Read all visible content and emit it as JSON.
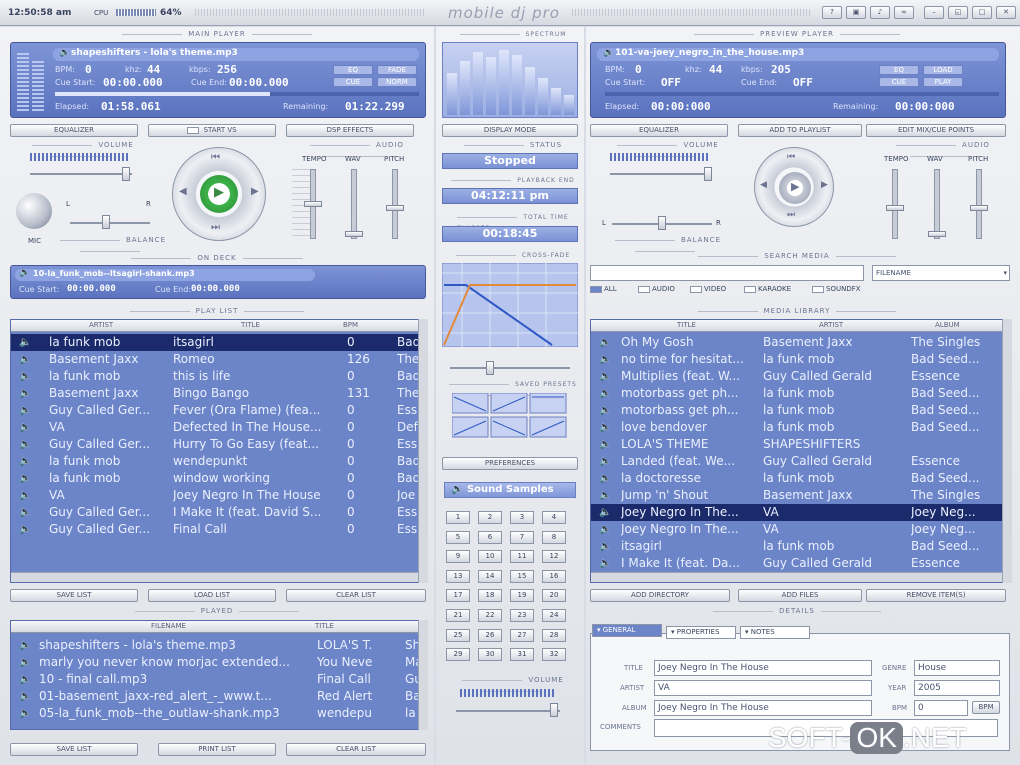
{
  "titlebar": {
    "clock": "12:50:58 am",
    "cpu_label": "CPU",
    "cpu_value": "64%",
    "app_title": "mobile dj pro",
    "window_buttons": [
      "?",
      "cam",
      "note",
      "link",
      "min",
      "max",
      "restore",
      "close"
    ]
  },
  "main_player": {
    "header": "Main Player",
    "track": "shapeshifters - lola's theme.mp3",
    "bpm_label": "BPM:",
    "bpm": "0",
    "khz_label": "khz:",
    "khz": "44",
    "kbps_label": "kbps:",
    "kbps": "256",
    "cue_start_label": "Cue Start:",
    "cue_start": "00:00.000",
    "cue_end_label": "Cue End:",
    "cue_end": "00:00.000",
    "mode_buttons": [
      "EQ",
      "FADE",
      "CUE",
      "NORM"
    ],
    "elapsed_label": "Elapsed:",
    "elapsed": "01:58.061",
    "remaining_label": "Remaining:",
    "remaining": "01:22.299",
    "progress": 0.59,
    "buttons": {
      "equalizer": "Equalizer",
      "start_vs": "Start VS",
      "dsp_effects": "DSP Effects"
    },
    "volume_header": "Volume",
    "audio_header": "Audio",
    "tempo": "Tempo",
    "wav": "WAV",
    "pitch": "Pitch",
    "mic": "MIC",
    "balance": "Balance",
    "l": "L",
    "r": "R"
  },
  "spectrum": {
    "header": "Spectrum Analyzer",
    "bars": [
      0.62,
      0.8,
      0.92,
      0.85,
      0.95,
      0.88,
      0.7,
      0.55,
      0.4,
      0.3
    ],
    "display_mode": "Display Mode",
    "status_header": "Status",
    "status": "Stopped",
    "playback_end_header": "Playback End",
    "playback_end": "04:12:11 pm",
    "total_elapsed_header": "Total Time Elapsed",
    "total_elapsed": "00:18:45",
    "crossfade_header": "Cross-fade",
    "saved_presets_header": "Saved Presets",
    "preferences": "Preferences",
    "sound_samples": "Sound Samples",
    "pads": [
      "1",
      "2",
      "3",
      "4",
      "5",
      "6",
      "7",
      "8",
      "9",
      "10",
      "11",
      "12",
      "13",
      "14",
      "15",
      "16",
      "17",
      "18",
      "19",
      "20",
      "21",
      "22",
      "23",
      "24",
      "25",
      "26",
      "27",
      "28",
      "29",
      "30",
      "31",
      "32"
    ],
    "volume": "Volume"
  },
  "on_deck": {
    "header": "On Deck",
    "track": "10-la_funk_mob--ltsagirl-shank.mp3",
    "cue_start_label": "Cue Start:",
    "cue_start": "00:00.000",
    "cue_end_label": "Cue End:",
    "cue_end": "00:00.000"
  },
  "playlist": {
    "header": "Play List",
    "columns": [
      "Artist",
      "Title",
      "BPM"
    ],
    "rows": [
      [
        "la funk mob",
        "itsagirl",
        "0",
        "Bad"
      ],
      [
        "Basement Jaxx",
        "Romeo",
        "126",
        "The"
      ],
      [
        "la funk mob",
        "this is life",
        "0",
        "Bad"
      ],
      [
        "Basement Jaxx",
        "Bingo Bango",
        "131",
        "The"
      ],
      [
        "Guy Called Ger...",
        "Fever (Ora Flame) (fea...",
        "0",
        "Ess"
      ],
      [
        "VA",
        "Defected In The House...",
        "0",
        "Def"
      ],
      [
        "Guy Called Ger...",
        "Hurry To Go Easy (feat...",
        "0",
        "Ess"
      ],
      [
        "la funk mob",
        "wendepunkt",
        "0",
        "Bad"
      ],
      [
        "la funk mob",
        "window working",
        "0",
        "Bad"
      ],
      [
        "VA",
        "Joey Negro In The House",
        "0",
        "Joe"
      ],
      [
        "Guy Called Ger...",
        "I Make It (feat. David S...",
        "0",
        "Ess"
      ],
      [
        "Guy Called Ger...",
        "Final Call",
        "0",
        "Ess"
      ]
    ],
    "buttons": [
      "Save List",
      "Load List",
      "Clear List"
    ]
  },
  "played": {
    "header": "Played",
    "columns": [
      "Filename",
      "Title"
    ],
    "rows": [
      [
        "shapeshifters - lola's theme.mp3",
        "LOLA'S T...",
        "Sh"
      ],
      [
        "marly you never know morjac extended...",
        "You Neve...",
        "Ma"
      ],
      [
        "10 - final call.mp3",
        "Final Call",
        "Gu"
      ],
      [
        "01-basement_jaxx-red_alert_-_www.t...",
        "Red Alert",
        "Ba"
      ],
      [
        "05-la_funk_mob--the_outlaw-shank.mp3",
        "wendepu...",
        "la"
      ]
    ],
    "buttons": [
      "Save List",
      "Print List",
      "Clear List"
    ]
  },
  "preview_player": {
    "header": "Preview Player",
    "track": "101-va-joey_negro_in_the_house.mp3",
    "bpm_label": "BPM:",
    "bpm": "0",
    "khz_label": "khz:",
    "khz": "44",
    "kbps_label": "kbps:",
    "kbps": "205",
    "cue_start_label": "Cue Start:",
    "cue_start": "OFF",
    "cue_end_label": "Cue End:",
    "cue_end": "OFF",
    "mode_buttons": [
      "EQ",
      "LOAD",
      "CUE",
      "PLAY"
    ],
    "elapsed_label": "Elapsed:",
    "elapsed": "00:00:000",
    "remaining_label": "Remaining:",
    "remaining": "00:00:000",
    "buttons": {
      "equalizer": "Equalizer",
      "add_playlist": "Add to Playlist",
      "edit_mix": "Edit Mix/Cue Points"
    },
    "volume_header": "Volume",
    "audio_header": "Audio",
    "tempo": "Tempo",
    "wav": "WAV",
    "pitch": "Pitch",
    "balance": "Balance",
    "l": "L",
    "r": "R"
  },
  "search": {
    "header": "Search Media",
    "value": "",
    "field_select": "Filename",
    "filters": [
      "All",
      "Audio",
      "Video",
      "Karaoke",
      "Soundfx"
    ]
  },
  "library": {
    "header": "Media Library",
    "columns": [
      "Title",
      "Artist",
      "Album"
    ],
    "rows": [
      [
        "Oh My Gosh",
        "Basement Jaxx",
        "The Singles"
      ],
      [
        "no time for hesitat...",
        "la funk mob",
        "Bad Seed..."
      ],
      [
        "Multiplies (feat. W...",
        "Guy Called Gerald",
        "Essence"
      ],
      [
        "motorbass get ph...",
        "la funk mob",
        "Bad Seed..."
      ],
      [
        "motorbass get ph...",
        "la funk mob",
        "Bad Seed..."
      ],
      [
        "love bendover",
        "la funk mob",
        "Bad Seed..."
      ],
      [
        "LOLA'S THEME",
        "SHAPESHIFTERS",
        ""
      ],
      [
        "Landed (feat. We...",
        "Guy Called Gerald",
        "Essence"
      ],
      [
        "la doctoresse",
        "la funk mob",
        "Bad Seed..."
      ],
      [
        "Jump 'n' Shout",
        "Basement Jaxx",
        "The Singles"
      ],
      [
        "Joey Negro In The...",
        "VA",
        "Joey Neg..."
      ],
      [
        "Joey Negro In The...",
        "VA",
        "Joey Neg..."
      ],
      [
        "itsagirl",
        "la funk mob",
        "Bad Seed..."
      ],
      [
        "I Make It (feat. Da...",
        "Guy Called Gerald",
        "Essence"
      ]
    ],
    "selected_index": 10,
    "buttons": [
      "Add Directory",
      "Add Files",
      "Remove Item(s)"
    ]
  },
  "details": {
    "header": "Details",
    "tabs": [
      "General",
      "Properties",
      "Notes"
    ],
    "title_label": "Title",
    "title": "Joey Negro In The House",
    "artist_label": "Artist",
    "artist": "VA",
    "album_label": "Album",
    "album": "Joey Negro In The House",
    "comments_label": "Comments",
    "comments": "",
    "genre_label": "Genre",
    "genre": "House",
    "year_label": "Year",
    "year": "2005",
    "bpm_label": "BPM",
    "bpm": "0",
    "bpm_button": "BPM"
  },
  "watermark": {
    "left": "SOFT-",
    "mid": "OK",
    "right": ".NET"
  },
  "colors": {
    "lcd": "#6a82cc",
    "table": "#6c84c8",
    "selected": "#1b2a6a",
    "play_green": "#3db34a"
  }
}
